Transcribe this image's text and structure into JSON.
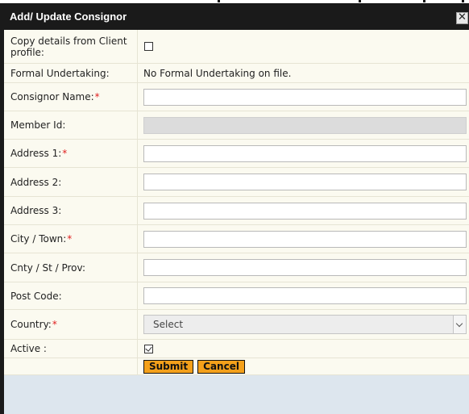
{
  "dialog": {
    "title": "Add/ Update Consignor",
    "close_label": "✕"
  },
  "form": {
    "copy_details": {
      "label": "Copy details from Client profile:",
      "checked": false
    },
    "formal_undertaking": {
      "label": "Formal Undertaking:",
      "value": "No Formal Undertaking on file."
    },
    "consignor_name": {
      "label": "Consignor Name:",
      "required": "*",
      "value": ""
    },
    "member_id": {
      "label": "Member Id:",
      "value": ""
    },
    "address1": {
      "label": "Address 1:",
      "required": "*",
      "value": ""
    },
    "address2": {
      "label": "Address 2:",
      "value": ""
    },
    "address3": {
      "label": "Address 3:",
      "value": ""
    },
    "city": {
      "label": "City / Town:",
      "required": "*",
      "value": ""
    },
    "county": {
      "label": "Cnty / St / Prov:",
      "value": ""
    },
    "post_code": {
      "label": "Post Code:",
      "value": ""
    },
    "country": {
      "label": "Country:",
      "required": "*",
      "selected": "Select"
    },
    "active": {
      "label": "Active :",
      "checked": true
    }
  },
  "actions": {
    "submit_label": "Submit",
    "cancel_label": "Cancel"
  },
  "colors": {
    "titlebar": "#1a1a1a",
    "form_background": "#fbfaf0",
    "button": "#f4a01a",
    "required": "#e02020",
    "footer": "#dde6ee"
  }
}
